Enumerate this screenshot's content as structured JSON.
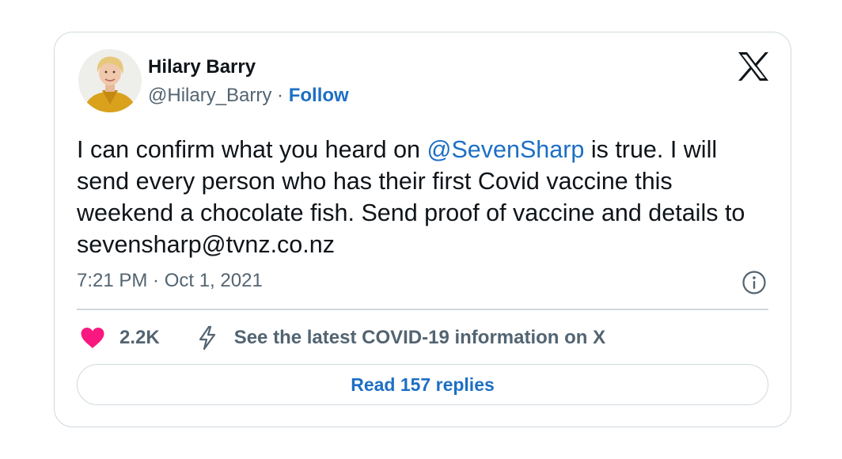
{
  "tweet": {
    "author": {
      "name": "Hilary Barry",
      "handle": "@Hilary_Barry",
      "separator": " · ",
      "follow_label": "Follow"
    },
    "text": {
      "before_mention": "I can confirm what you heard on ",
      "mention": "@SevenSharp",
      "after_mention": " is true. I will send every person who has their first Covid vaccine this weekend a chocolate fish. Send proof of vaccine and details to sevensharp@tvnz.co.nz"
    },
    "timestamp": "7:21 PM · Oct 1, 2021",
    "likes": "2.2K",
    "info_link": "See the latest COVID-19 information on X",
    "replies_button": "Read 157 replies"
  },
  "colors": {
    "link": "#1d6fc4",
    "heart": "#f91880",
    "secondary_text": "#536471",
    "border": "#cfd9de"
  },
  "icons": [
    "x-logo-icon",
    "info-icon",
    "heart-icon",
    "bolt-icon"
  ]
}
